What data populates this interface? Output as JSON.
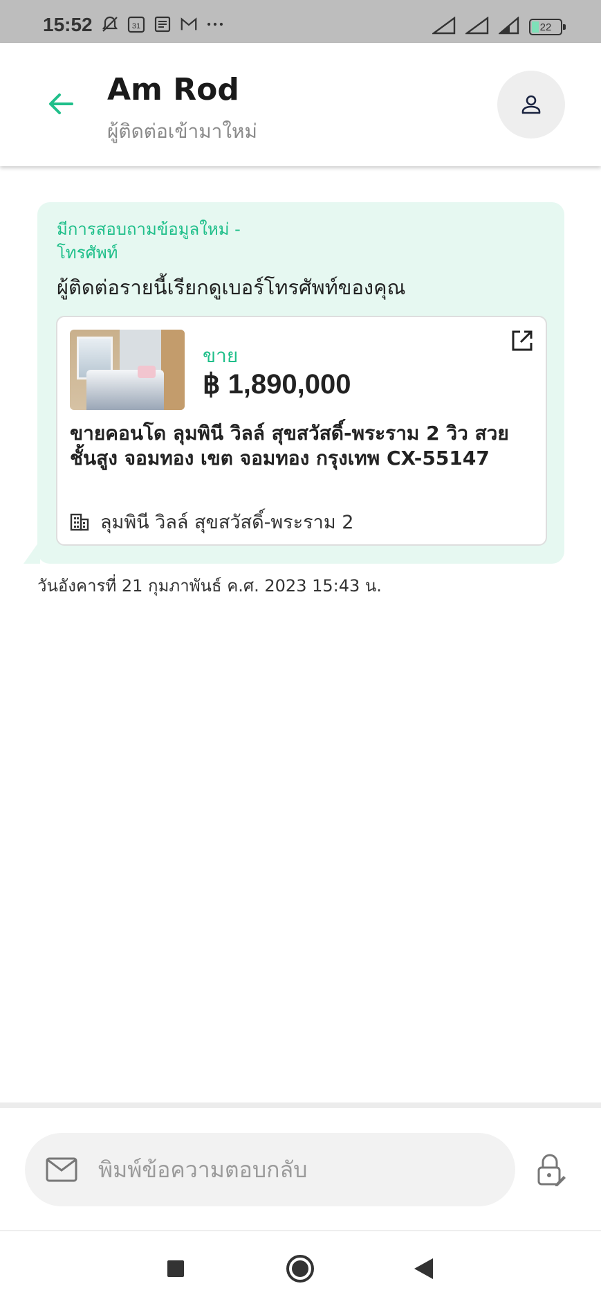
{
  "status_bar": {
    "time": "15:52",
    "calendar_day": "31",
    "battery": "22",
    "icons_left": [
      "notifications-off-icon",
      "calendar-icon",
      "news-icon",
      "gmail-icon",
      "more-dots-icon"
    ],
    "icons_right": [
      "signal-icon",
      "signal-icon",
      "signal-icon",
      "battery-icon"
    ]
  },
  "header": {
    "title": "Am Rod",
    "subtitle": "ผู้ติดต่อเข้ามาใหม่",
    "back_icon": "arrow-back-icon",
    "profile_icon": "person-icon"
  },
  "message": {
    "inquiry_title": "มีการสอบถามข้อมูลใหม่ - โทรศัพท์",
    "inquiry_text": "ผู้ติดต่อรายนี้เรียกดูเบอร์โทรศัพท์ของคุณ",
    "listing": {
      "type": "ขาย",
      "price": "฿ 1,890,000",
      "title": "ขายคอนโด  ลุมพินี วิลล์ สุขสวัสดิ์-พระราม 2 วิว สวย ชั้นสูง จอมทอง เขต จอมทอง กรุงเทพ CX-55147",
      "project": "ลุมพินี วิลล์ สุขสวัสดิ์-พระราม 2"
    },
    "timestamp": "วันอังคารที่ 21 กุมภาพันธ์ ค.ศ. 2023 15:43 น."
  },
  "composer": {
    "placeholder": "พิมพ์ข้อความตอบกลับ"
  },
  "colors": {
    "accent": "#1fbf8a",
    "bubble_bg": "#e6f8f1",
    "status_bar_bg": "#bdbdbd"
  }
}
